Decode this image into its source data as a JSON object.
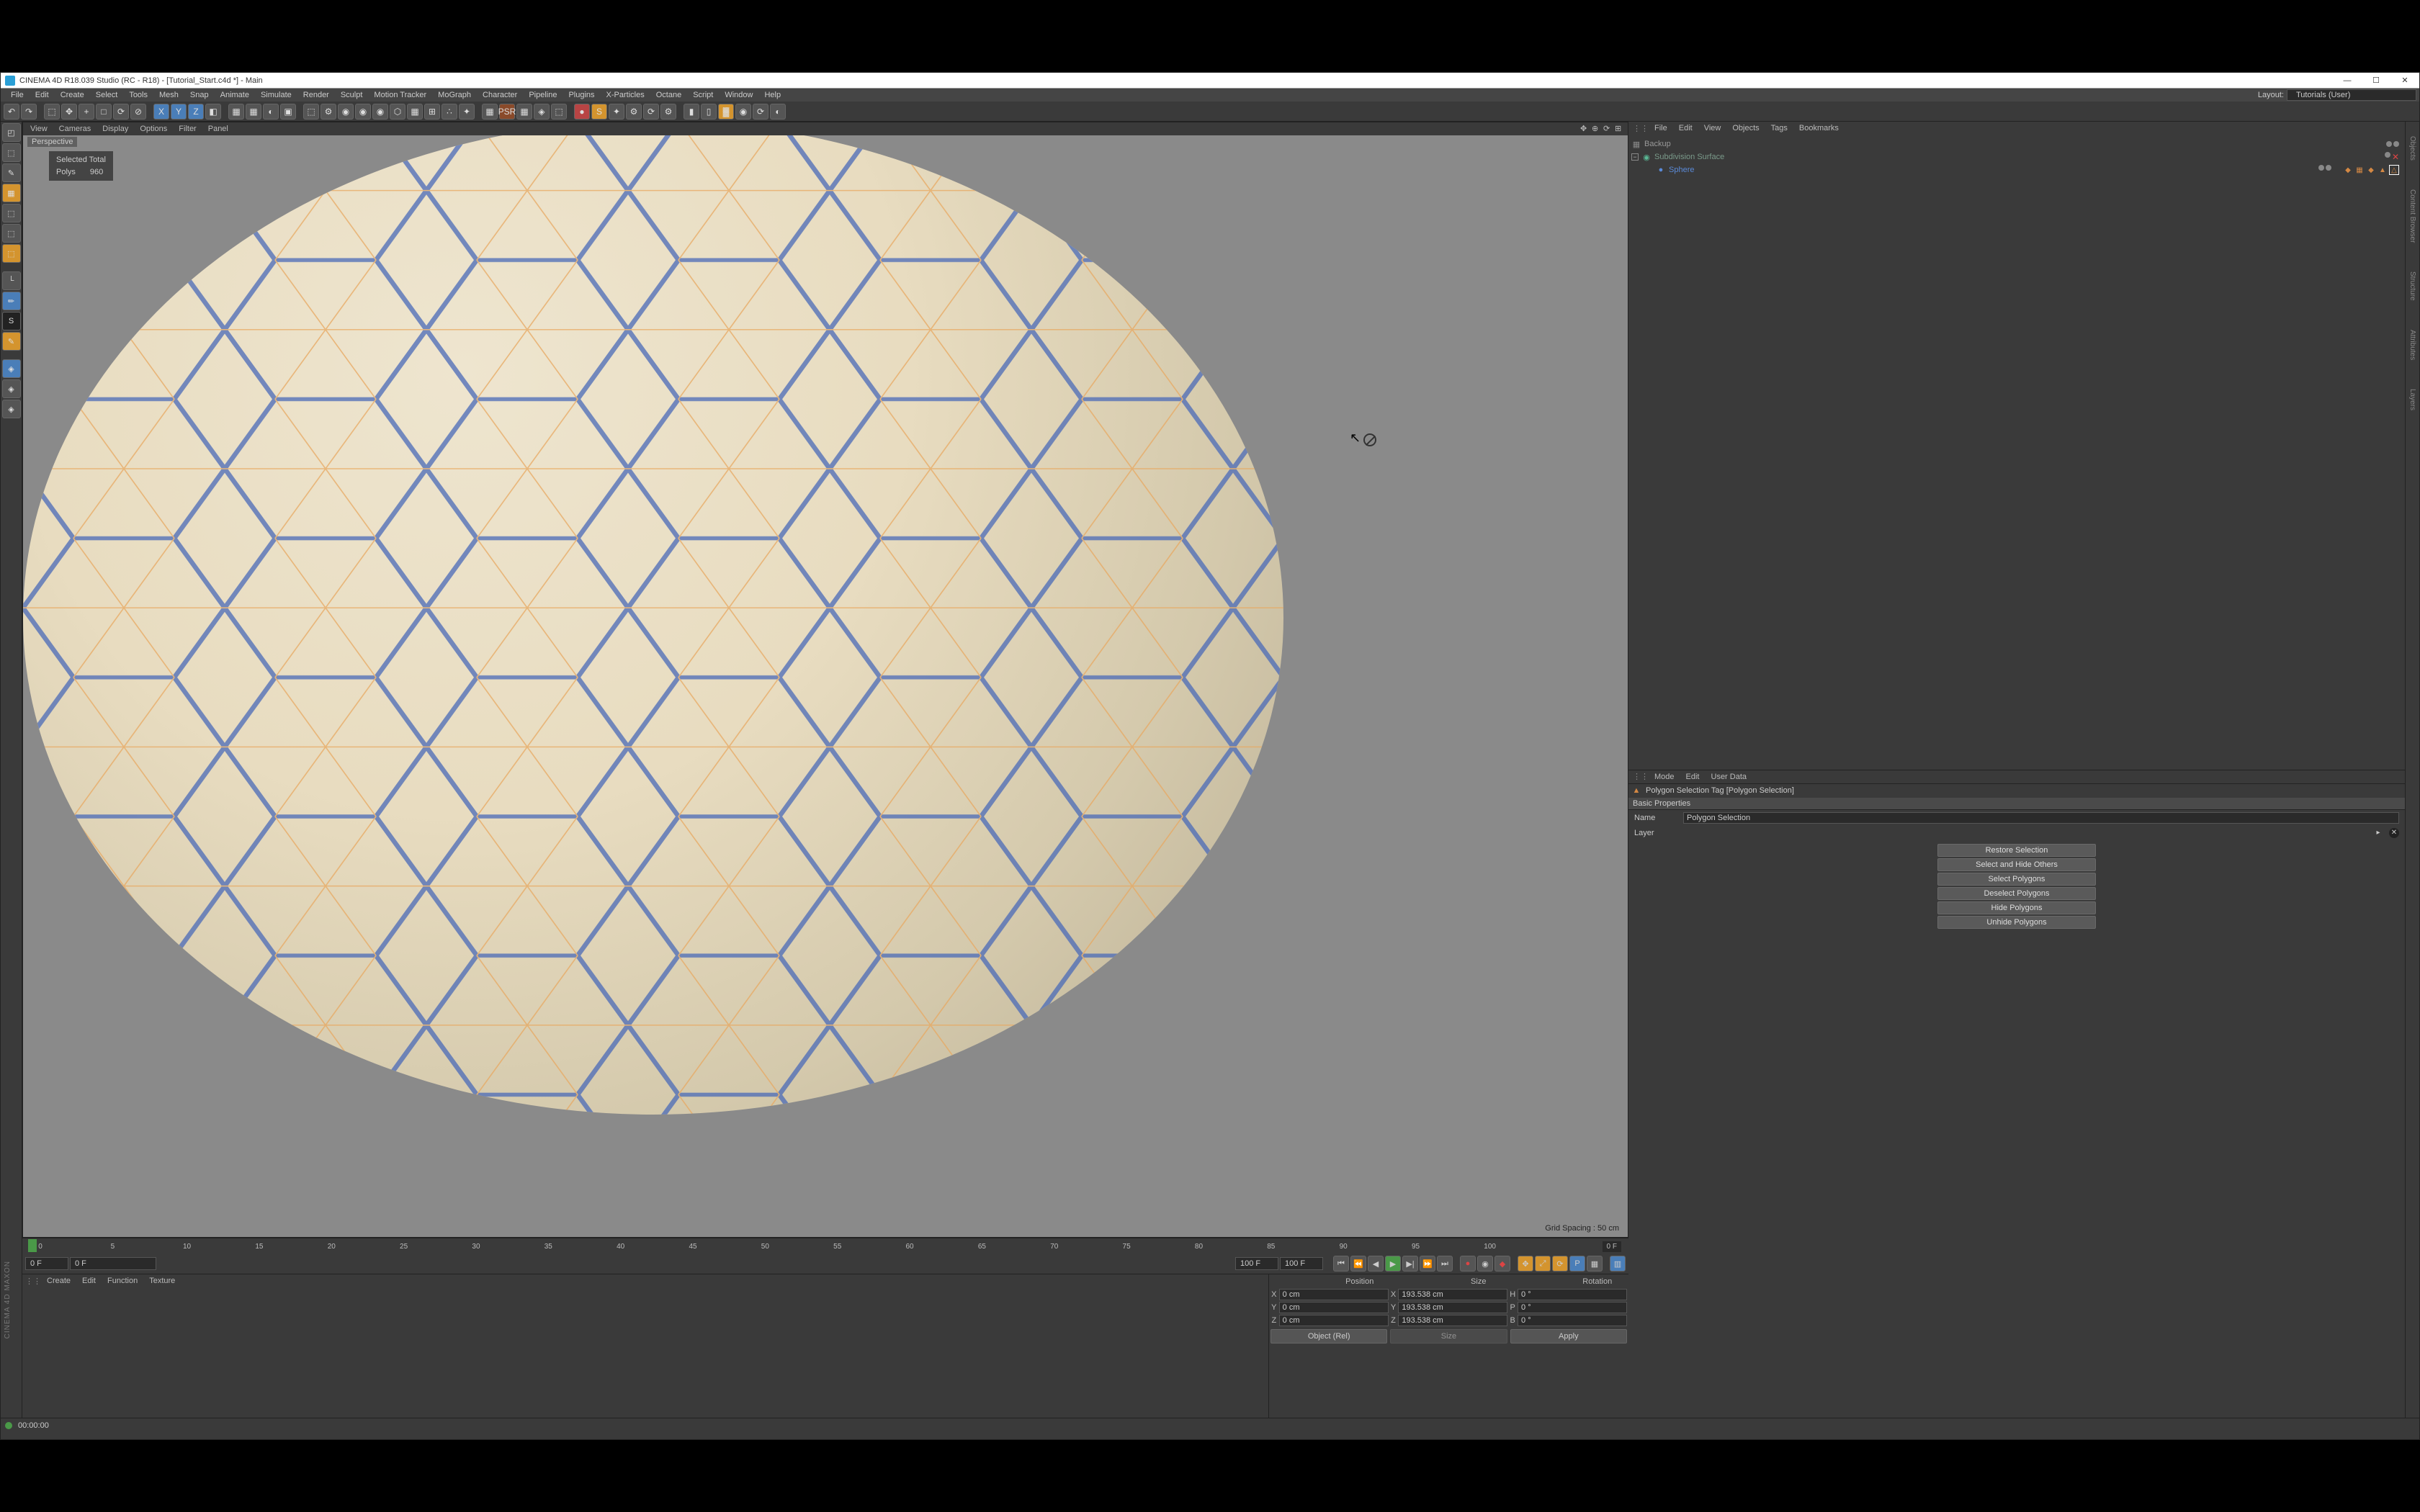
{
  "titlebar": {
    "title": "CINEMA 4D R18.039 Studio (RC - R18) - [Tutorial_Start.c4d *] - Main",
    "min": "—",
    "max": "☐",
    "close": "✕"
  },
  "menubar": {
    "items": [
      "File",
      "Edit",
      "Create",
      "Select",
      "Tools",
      "Mesh",
      "Snap",
      "Animate",
      "Simulate",
      "Render",
      "Sculpt",
      "Motion Tracker",
      "MoGraph",
      "Character",
      "Pipeline",
      "Plugins",
      "X-Particles",
      "Octane",
      "Script",
      "Window",
      "Help"
    ],
    "layout_label": "Layout:",
    "layout_value": "Tutorials (User)"
  },
  "toolbar_icons": [
    "↶",
    "↷",
    "",
    "⬚",
    "✥",
    "+",
    "□",
    "⟳",
    "⊘",
    "",
    "X",
    "Y",
    "Z",
    "◧",
    "",
    "▦",
    "▦",
    "◐",
    "▣",
    "",
    "⬚",
    "⚙",
    "◉",
    "◉",
    "◉",
    "⬡",
    "▦",
    "⊞",
    "∴",
    "✦",
    "",
    "▦",
    "PSR",
    "▦",
    "◈",
    "⬚",
    "",
    "●",
    "S",
    "✦",
    "⚙",
    "⟳",
    "⚙",
    "",
    "▮",
    "▯",
    "▓",
    "◉",
    "⟳",
    "◐"
  ],
  "left_tools": [
    "◰",
    "⬚",
    "✎",
    "▦",
    "⬚",
    "⬚",
    "⬚",
    "",
    "└",
    "✏",
    "S",
    "✎",
    "",
    "◈",
    "◈",
    "◈"
  ],
  "viewport_menu": {
    "items": [
      "View",
      "Cameras",
      "Display",
      "Options",
      "Filter",
      "Panel"
    ]
  },
  "viewport": {
    "label": "Perspective",
    "stats_line1": "Selected Total",
    "stats_line2": "Polys",
    "stats_val": "960",
    "grid_spacing": "Grid Spacing : 50 cm"
  },
  "timeline": {
    "ticks": [
      "0",
      "5",
      "10",
      "15",
      "20",
      "25",
      "30",
      "35",
      "40",
      "45",
      "50",
      "55",
      "60",
      "65",
      "70",
      "75",
      "80",
      "85",
      "90",
      "95",
      "100"
    ],
    "end_marker": "0 F",
    "start_frame": "0 F",
    "cf_from": "0 F",
    "cf_end": "100 F",
    "cf_total": "100 F"
  },
  "material_menu": {
    "items": [
      "Create",
      "Edit",
      "Function",
      "Texture"
    ]
  },
  "coords": {
    "headers": [
      "Position",
      "Size",
      "Rotation"
    ],
    "rows": [
      {
        "axis": "X",
        "pos": "0 cm",
        "size": "193.538 cm",
        "rot_lbl": "H",
        "rot": "0 °"
      },
      {
        "axis": "Y",
        "pos": "0 cm",
        "size": "193.538 cm",
        "rot_lbl": "P",
        "rot": "0 °"
      },
      {
        "axis": "Z",
        "pos": "0 cm",
        "size": "193.538 cm",
        "rot_lbl": "B",
        "rot": "0 °"
      }
    ],
    "mode": "Object (Rel)",
    "size_mode": "Size",
    "apply": "Apply"
  },
  "obj_menu": {
    "items": [
      "File",
      "Edit",
      "View",
      "Objects",
      "Tags",
      "Bookmarks"
    ]
  },
  "tree": {
    "n0": "Backup",
    "n1": "Subdivision Surface",
    "n2": "Sphere"
  },
  "attr_menu": {
    "items": [
      "Mode",
      "Edit",
      "User Data"
    ]
  },
  "attr": {
    "header": "Polygon Selection Tag [Polygon Selection]",
    "section": "Basic Properties",
    "name_lbl": "Name",
    "name_val": "Polygon Selection",
    "layer_lbl": "Layer",
    "buttons": [
      "Restore Selection",
      "Select and Hide Others",
      "Select Polygons",
      "Deselect Polygons",
      "Hide Polygons",
      "Unhide Polygons"
    ]
  },
  "right_tabs": [
    "Objects",
    "Content Browser",
    "Structure",
    "Attributes",
    "Layers"
  ],
  "status": {
    "time": "00:00:00"
  },
  "maxon": "CINEMA 4D\nMAXON"
}
